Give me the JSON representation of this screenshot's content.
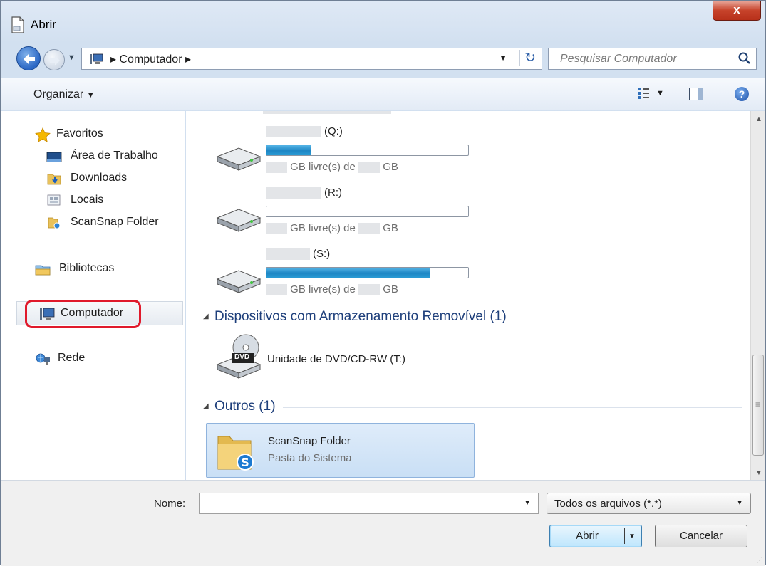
{
  "window": {
    "title": "Abrir",
    "close_label": "x"
  },
  "nav": {
    "address_path": "Computador",
    "search_placeholder": "Pesquisar Computador"
  },
  "toolbar": {
    "organize_label": "Organizar"
  },
  "sidebar": {
    "favorites": "Favoritos",
    "items": [
      {
        "label": "Área de Trabalho",
        "icon": "desktop-icon"
      },
      {
        "label": "Downloads",
        "icon": "downloads-folder-icon"
      },
      {
        "label": "Locais",
        "icon": "locations-icon"
      },
      {
        "label": "ScanSnap Folder",
        "icon": "scansnap-folder-icon"
      }
    ],
    "libraries": "Bibliotecas",
    "computer": "Computador",
    "network": "Rede"
  },
  "content": {
    "drives": [
      {
        "letter": "(Q:)",
        "free_label": "GB livre(s) de",
        "unit": "GB",
        "used_fraction": 0.22
      },
      {
        "letter": "(R:)",
        "free_label": "GB livre(s) de",
        "unit": "GB",
        "used_fraction": 0.0
      },
      {
        "letter": "(S:)",
        "free_label": "GB livre(s) de",
        "unit": "GB",
        "used_fraction": 0.81
      }
    ],
    "removable_group": "Dispositivos com Armazenamento Removível (1)",
    "dvd_label": "Unidade de DVD/CD-RW (T:)",
    "dvd_badge": "DVD",
    "others_group": "Outros (1)",
    "folder_title": "ScanSnap Folder",
    "folder_subtitle": "Pasta do Sistema"
  },
  "bottom": {
    "name_label": "Nome:",
    "name_value": "",
    "file_type": "Todos os arquivos (*.*)",
    "open_label": "Abrir",
    "cancel_label": "Cancelar"
  },
  "colors": {
    "highlight": "#e0192b",
    "bar": "#1d86c4",
    "group_header": "#1e3f7b"
  }
}
